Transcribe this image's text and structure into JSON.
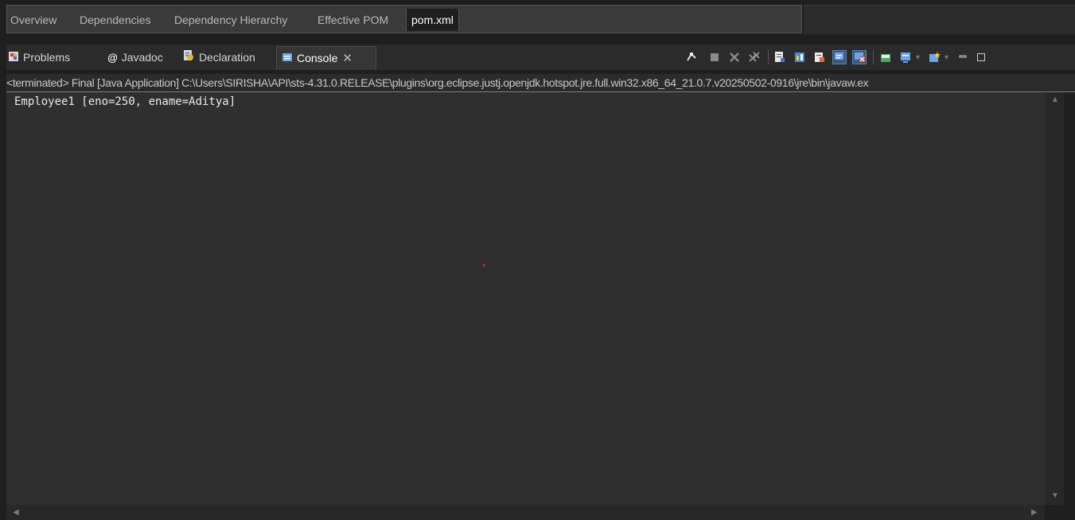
{
  "editor_tabs": [
    "Overview",
    "Dependencies",
    "Dependency Hierarchy",
    "Effective POM",
    "pom.xml"
  ],
  "view_tabs": {
    "problems": "Problems",
    "javadoc": "Javadoc",
    "declaration": "Declaration",
    "console": "Console",
    "close_glyph": "✕"
  },
  "toolbar_icons": [
    "pin-console-icon",
    "terminate-icon",
    "remove-launch-icon",
    "remove-all-terminated-icon",
    "scroll-lock-icon",
    "word-wrap-icon",
    "show-on-output-icon",
    "show-on-error-icon",
    "clear-console-icon",
    "open-console-icon",
    "new-console-icon",
    "minimize-icon",
    "maximize-icon"
  ],
  "status_line": "<terminated> Final [Java Application] C:\\Users\\SIRISHA\\API\\sts-4.31.0.RELEASE\\plugins\\org.eclipse.justj.openjdk.hotspot.jre.full.win32.x86_64_21.0.7.v20250502-0916\\jre\\bin\\javaw.ex",
  "console_output": "Employee1 [eno=250, ename=Aditya]",
  "colors": {
    "background": "#1f1f1f",
    "console_bg": "#2f2f2f",
    "accent_pressed": "#3e5a7a",
    "red_dot": "#e02020"
  }
}
